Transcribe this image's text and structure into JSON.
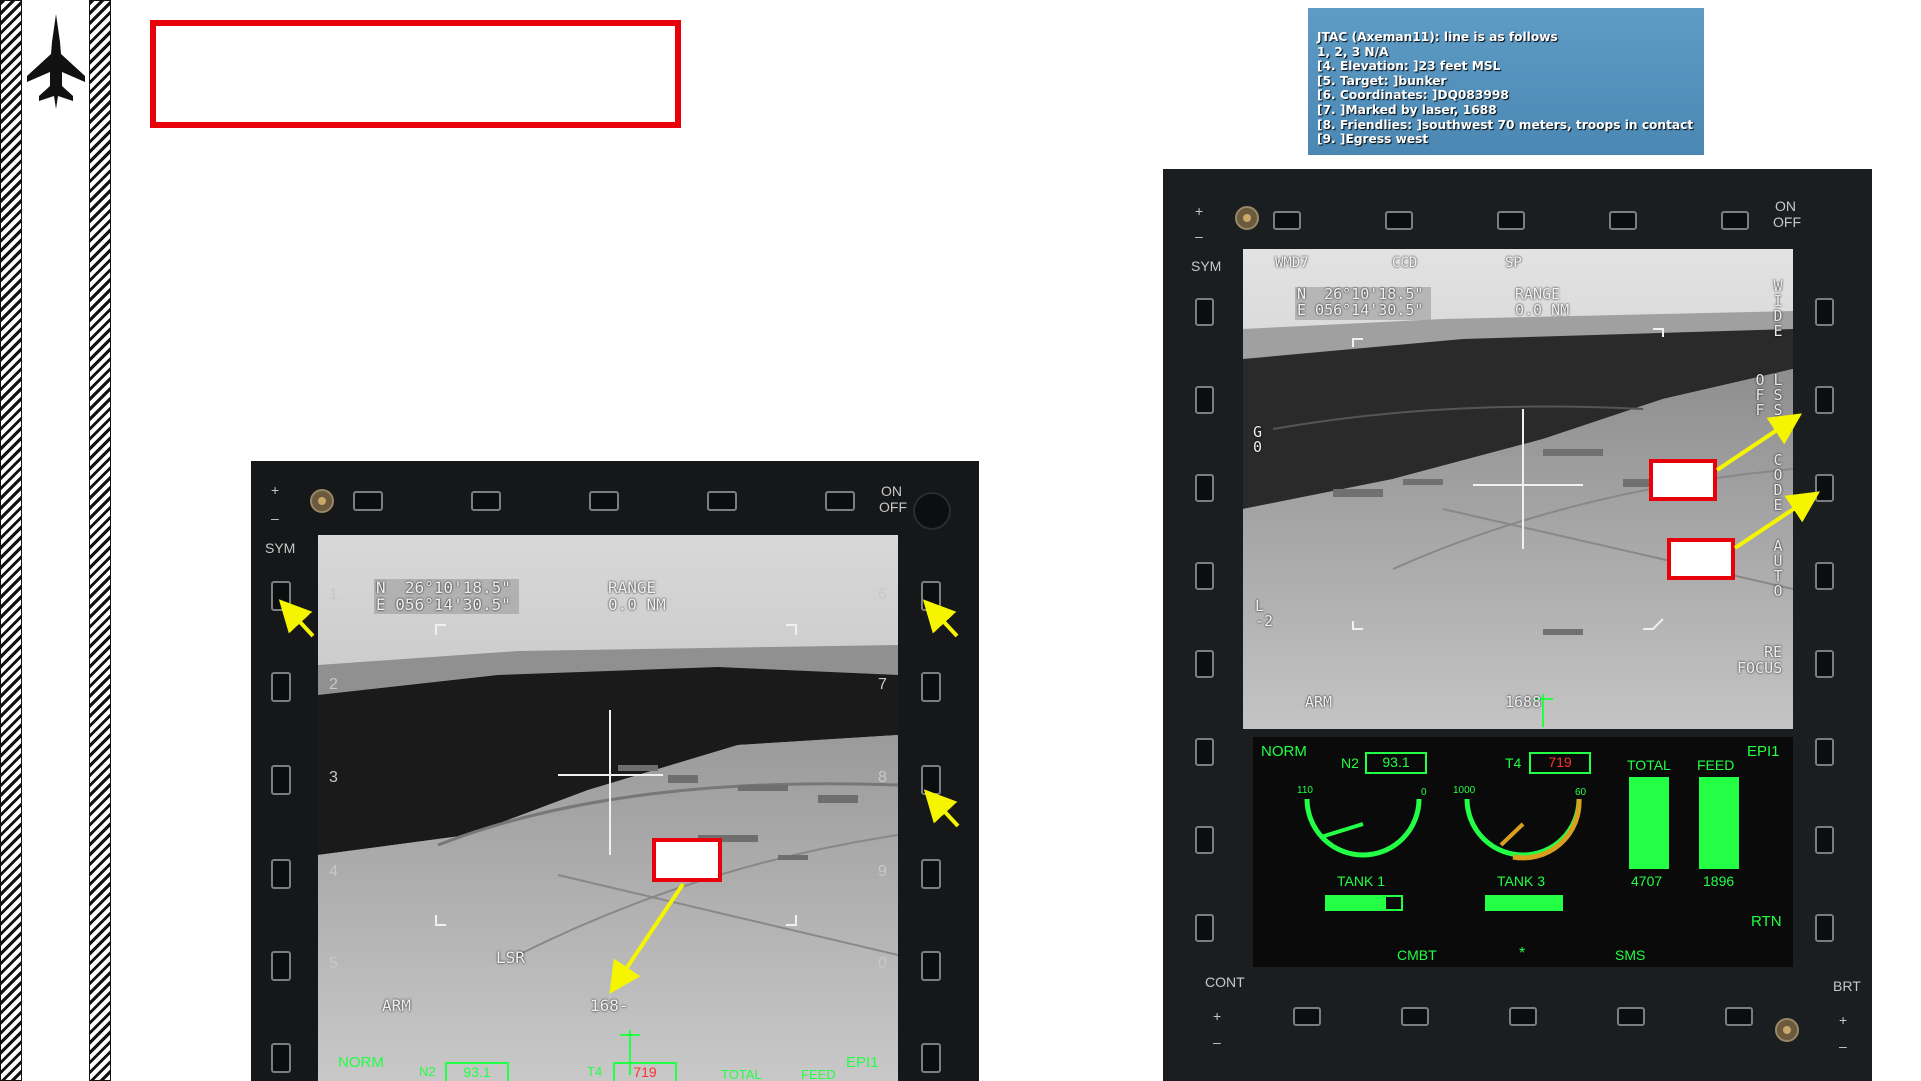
{
  "jtac": {
    "lines": [
      "JTAC (Axeman11): line is as follows",
      "1, 2, 3 N/A",
      "[4. Elevation: ]23 feet MSL",
      "[5. Target: ]bunker",
      "[6. Coordinates: ]DQ083998",
      "[7. ]Marked by laser, 1688",
      "[8. Friendlies: ]southwest 70 meters, troops in contact",
      "[9. ]Egress west"
    ]
  },
  "left_mfd": {
    "power": [
      "ON",
      "OFF"
    ],
    "sym": "SYM",
    "button_numbers": [
      "1",
      "2",
      "3",
      "4",
      "5",
      "6",
      "7",
      "8",
      "9",
      "0"
    ],
    "coords": "N  26°10'18.5\"\nE 056°14'30.5\"",
    "range": "RANGE\n0.0 NM",
    "lsr": "LSR",
    "arm": "ARM",
    "laser_code": "168-",
    "engine": {
      "mode": "NORM",
      "n2_label": "N2",
      "n2": "93.1",
      "t4_label": "T4",
      "t4": "719",
      "total": "TOTAL",
      "feed": "FEED",
      "page": "EPI1"
    }
  },
  "right_mfd": {
    "power": [
      "ON",
      "OFF"
    ],
    "sym": "SYM",
    "top_tabs": [
      "WMD7",
      "CCD",
      "SP"
    ],
    "coords": "N  26°10'18.5\"\nE 056°14'30.5\"",
    "range": "RANGE\n0.0 NM",
    "go": "G\n0",
    "l2": "L\n-2",
    "right_options": [
      "WIDE",
      "LSS",
      "OFF",
      "CODE",
      "AUTO"
    ],
    "refocus": "RE\nFOCUS",
    "arm": "ARM",
    "laser_code": "1688",
    "engine": {
      "mode": "NORM",
      "page": "EPI1",
      "n2_label": "N2",
      "n2": "93.1",
      "n2_min": "110",
      "n2_max": "0",
      "t4_label": "T4",
      "t4": "719",
      "t4_min": "1000",
      "t4_max": "60",
      "total_label": "TOTAL",
      "total": "4707",
      "feed_label": "FEED",
      "feed": "1896",
      "tank1": "TANK 1",
      "tank3": "TANK 3",
      "rtn": "RTN"
    },
    "bottom_tabs": [
      "CMBT",
      "*",
      "SMS"
    ],
    "cont": "CONT",
    "brt": "BRT"
  },
  "colors": {
    "hud_green": "#22ff44",
    "annotation_red": "#e8000b",
    "arrow_yellow": "#f5f500",
    "jtac_blue": "#4a88b3"
  }
}
